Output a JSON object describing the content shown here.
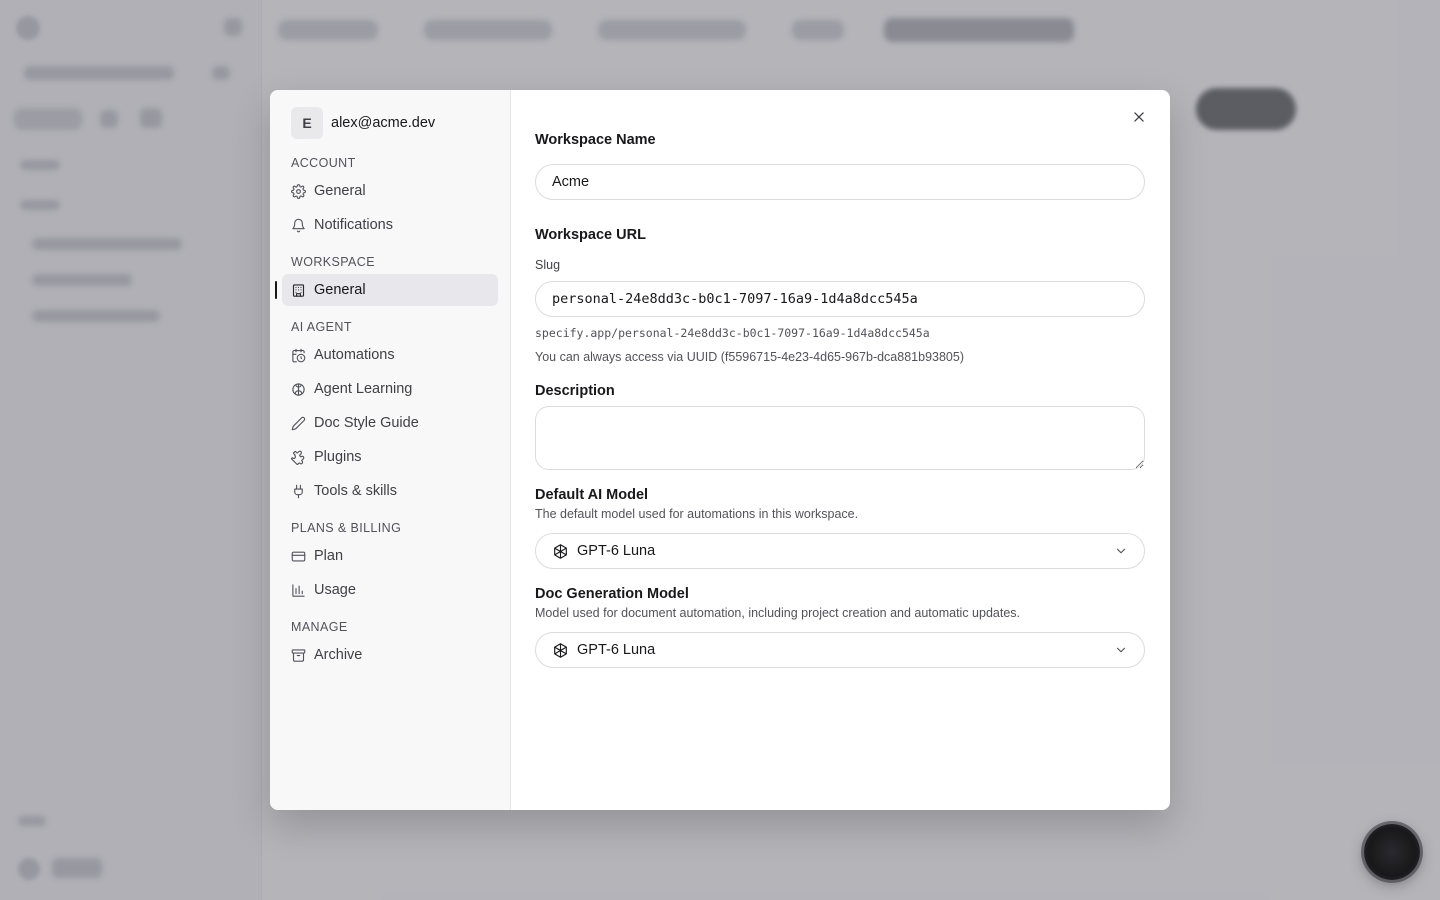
{
  "user": {
    "avatar_initial": "E",
    "email": "alex@acme.dev"
  },
  "sidebar": {
    "sections": [
      {
        "label": "ACCOUNT",
        "items": [
          {
            "label": "General",
            "icon": "gear-icon"
          },
          {
            "label": "Notifications",
            "icon": "bell-icon"
          }
        ]
      },
      {
        "label": "WORKSPACE",
        "items": [
          {
            "label": "General",
            "icon": "building-icon",
            "active": true
          }
        ]
      },
      {
        "label": "AI AGENT",
        "items": [
          {
            "label": "Automations",
            "icon": "calendar-clock-icon"
          },
          {
            "label": "Agent Learning",
            "icon": "brain-icon"
          },
          {
            "label": "Doc Style Guide",
            "icon": "pen-icon"
          },
          {
            "label": "Plugins",
            "icon": "puzzle-icon"
          },
          {
            "label": "Tools & skills",
            "icon": "plug-icon"
          }
        ]
      },
      {
        "label": "PLANS & BILLING",
        "items": [
          {
            "label": "Plan",
            "icon": "credit-card-icon"
          },
          {
            "label": "Usage",
            "icon": "bar-chart-icon"
          }
        ]
      },
      {
        "label": "MANAGE",
        "items": [
          {
            "label": "Archive",
            "icon": "archive-icon"
          }
        ]
      }
    ]
  },
  "form": {
    "workspace_name": {
      "label": "Workspace Name",
      "value": "Acme"
    },
    "workspace_url": {
      "label": "Workspace URL",
      "slug_label": "Slug",
      "slug_value": "personal-24e8dd3c-b0c1-7097-16a9-1d4a8dcc545a",
      "preview": "specify.app/personal-24e8dd3c-b0c1-7097-16a9-1d4a8dcc545a",
      "uuid_note": "You can always access via UUID (f5596715-4e23-4d65-967b-dca881b93805)"
    },
    "description": {
      "label": "Description",
      "value": ""
    },
    "default_ai_model": {
      "label": "Default AI Model",
      "help": "The default model used for automations in this workspace.",
      "value": "GPT-6 Luna"
    },
    "doc_generation_model": {
      "label": "Doc Generation Model",
      "help": "Model used for document automation, including project creation and automatic updates.",
      "value": "GPT-6 Luna"
    }
  },
  "colors": {
    "overlay": "#78787f",
    "active_bg": "#e8e8ec",
    "text": "#18181b"
  }
}
